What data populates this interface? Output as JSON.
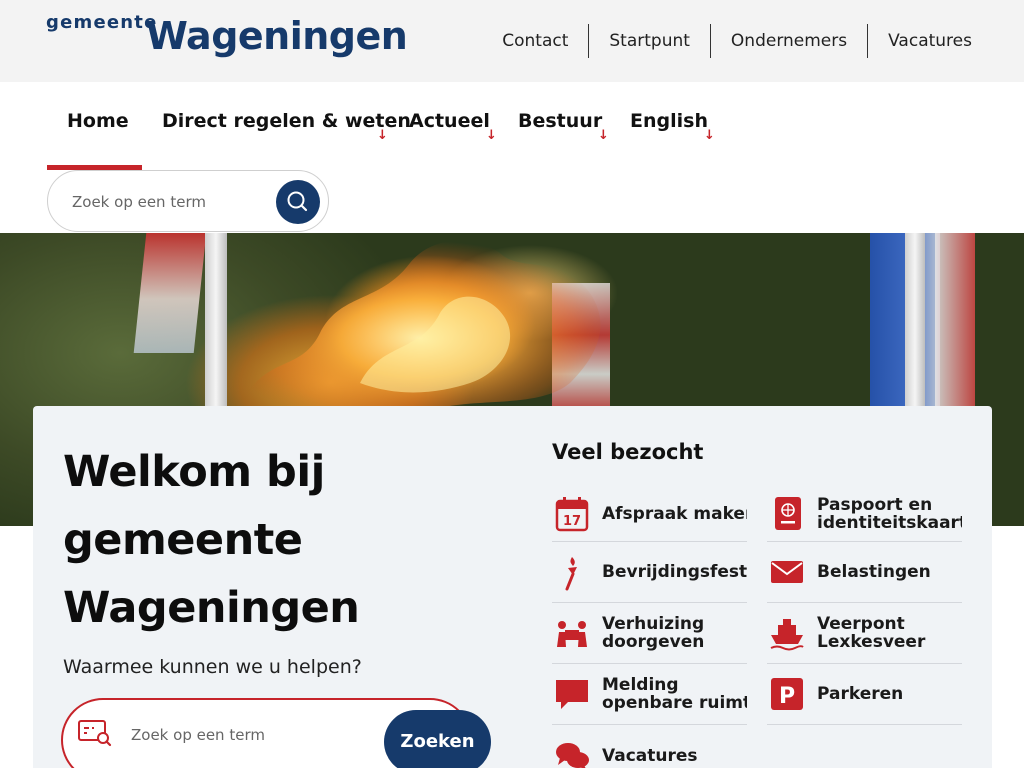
{
  "logo": {
    "small": "gemeente",
    "big": "Wageningen"
  },
  "top_links": [
    "Contact",
    "Startpunt",
    "Ondernemers",
    "Vacatures"
  ],
  "nav": {
    "items": [
      {
        "label": "Home",
        "active": true
      },
      {
        "label": "Direct regelen & weten",
        "dropdown": true
      },
      {
        "label": "Actueel",
        "dropdown": true
      },
      {
        "label": "Bestuur",
        "dropdown": true
      },
      {
        "label": "English",
        "dropdown": true
      }
    ],
    "arrow_glyph": "↓"
  },
  "search_top": {
    "placeholder": "Zoek op een term"
  },
  "welcome": {
    "title_line1": "Welkom bij",
    "title_line2": "gemeente",
    "title_line3": "Wageningen",
    "help": "Waarmee kunnen we u helpen?",
    "search_placeholder": "Zoek op een term",
    "search_button": "Zoeken"
  },
  "veel_bezocht": {
    "title": "Veel bezocht",
    "left": [
      {
        "line1": "Afspraak maken",
        "line2": "",
        "icon": "calendar-icon",
        "calendar_day": "17"
      },
      {
        "line1": "Bevrijdingsfestival",
        "line2": "",
        "icon": "torch-icon"
      },
      {
        "line1": "Verhuizing",
        "line2": "doorgeven",
        "icon": "moving-people-icon"
      },
      {
        "line1": "Melding",
        "line2": "openbare ruimte",
        "icon": "speech-bubble-icon"
      },
      {
        "line1": "Vacatures",
        "line2": "",
        "icon": "chat-bubbles-icon"
      }
    ],
    "right": [
      {
        "line1": "Paspoort en",
        "line2": "identiteitskaart",
        "icon": "passport-icon"
      },
      {
        "line1": "Belastingen",
        "line2": "",
        "icon": "envelope-icon"
      },
      {
        "line1": "Veerpont",
        "line2": "Lexkesveer",
        "icon": "ferry-icon"
      },
      {
        "line1": "Parkeren",
        "line2": "",
        "icon": "parking-icon",
        "parking_letter": "P"
      }
    ]
  },
  "colors": {
    "brand_blue": "#163a6b",
    "accent_red": "#c6242a",
    "card_bg": "#f0f3f6",
    "topbar_bg": "#f3f3f3"
  }
}
